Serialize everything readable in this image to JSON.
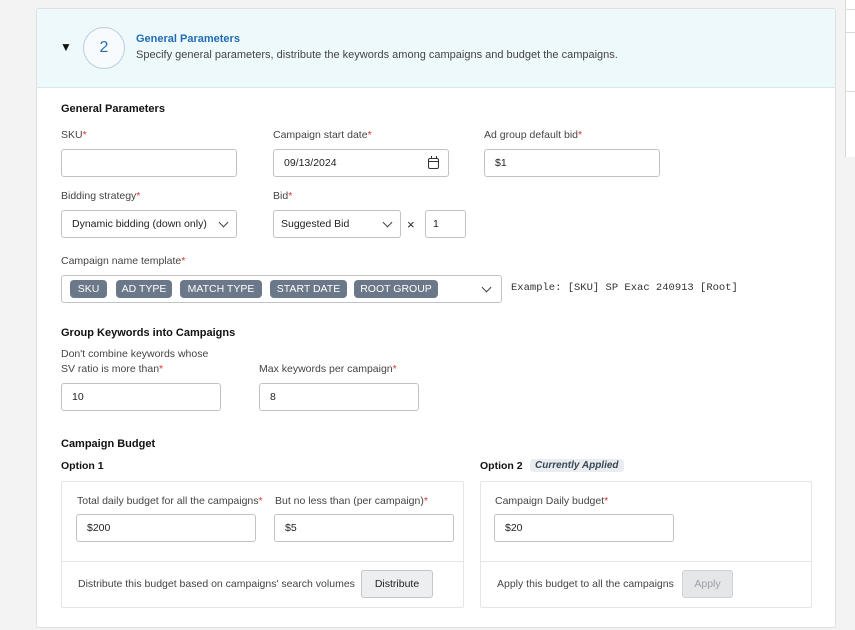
{
  "step": {
    "number": "2",
    "title": "General Parameters",
    "description": "Specify general parameters, distribute the keywords among campaigns and budget the campaigns."
  },
  "general": {
    "section_title": "General Parameters",
    "sku": {
      "label": "SKU",
      "value": ""
    },
    "start_date": {
      "label": "Campaign start date",
      "value": "09/13/2024"
    },
    "ad_group_bid": {
      "label": "Ad group default bid",
      "value": "$1"
    },
    "bidding_strategy": {
      "label": "Bidding strategy",
      "value": "Dynamic bidding (down only)"
    },
    "bid": {
      "label": "Bid",
      "value": "Suggested Bid",
      "multiplier_symbol": "×",
      "multiplier": "1"
    },
    "name_template": {
      "label": "Campaign name template",
      "chips": [
        "SKU",
        "AD TYPE",
        "MATCH TYPE",
        "START DATE",
        "ROOT GROUP"
      ],
      "example": "Example: [SKU] SP Exac 240913 [Root]"
    }
  },
  "grouping": {
    "section_title": "Group Keywords into Campaigns",
    "sv_ratio": {
      "label_line1": "Don't combine keywords whose",
      "label_line2": "SV ratio is more than",
      "value": "10"
    },
    "max_keywords": {
      "label": "Max keywords per campaign",
      "value": "8"
    }
  },
  "budget": {
    "section_title": "Campaign Budget",
    "option1": {
      "title": "Option 1",
      "total_label": "Total daily budget for all the campaigns",
      "total_value": "$200",
      "min_label": "But no less than (per campaign)",
      "min_value": "$5",
      "footer_text": "Distribute this budget based on campaigns' search volumes",
      "button": "Distribute"
    },
    "option2": {
      "title": "Option 2",
      "badge": "Currently Applied",
      "daily_label": "Campaign Daily budget",
      "daily_value": "$20",
      "footer_text": "Apply this budget to all the campaigns",
      "button": "Apply"
    }
  },
  "required_mark": "*"
}
